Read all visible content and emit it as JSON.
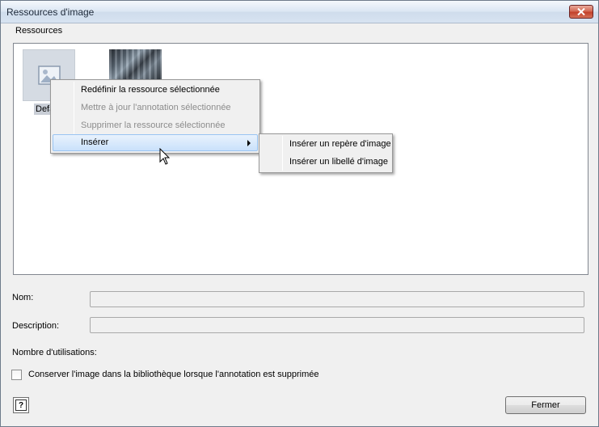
{
  "window": {
    "title": "Ressources d'image"
  },
  "menubar": {
    "label": "Ressources"
  },
  "thumbnails": [
    {
      "label": "Defa"
    }
  ],
  "context_menu": {
    "items": [
      {
        "label": "Redéfinir la ressource sélectionnée",
        "enabled": true
      },
      {
        "label": "Mettre à jour l'annotation sélectionnée",
        "enabled": false
      },
      {
        "label": "Supprimer la ressource sélectionnée",
        "enabled": false
      },
      {
        "label": "Insérer",
        "enabled": true,
        "selected": true,
        "has_submenu": true
      }
    ]
  },
  "submenu": {
    "items": [
      {
        "label": "Insérer un repère d'image"
      },
      {
        "label": "Insérer un libellé d'image"
      }
    ]
  },
  "form": {
    "name_label": "Nom:",
    "name_value": "",
    "description_label": "Description:",
    "description_value": "",
    "usage_label": "Nombre d'utilisations:"
  },
  "options": {
    "keep_image_label": "Conserver l'image dans la bibliothèque lorsque l'annotation est supprimée",
    "keep_image_checked": false
  },
  "buttons": {
    "help_symbol": "?",
    "close_label": "Fermer"
  },
  "icons": {
    "window_close": "close-icon",
    "placeholder_image": "image-icon",
    "pointer": "mouse-cursor-icon",
    "help": "help-icon",
    "submenu": "chevron-right-icon"
  }
}
